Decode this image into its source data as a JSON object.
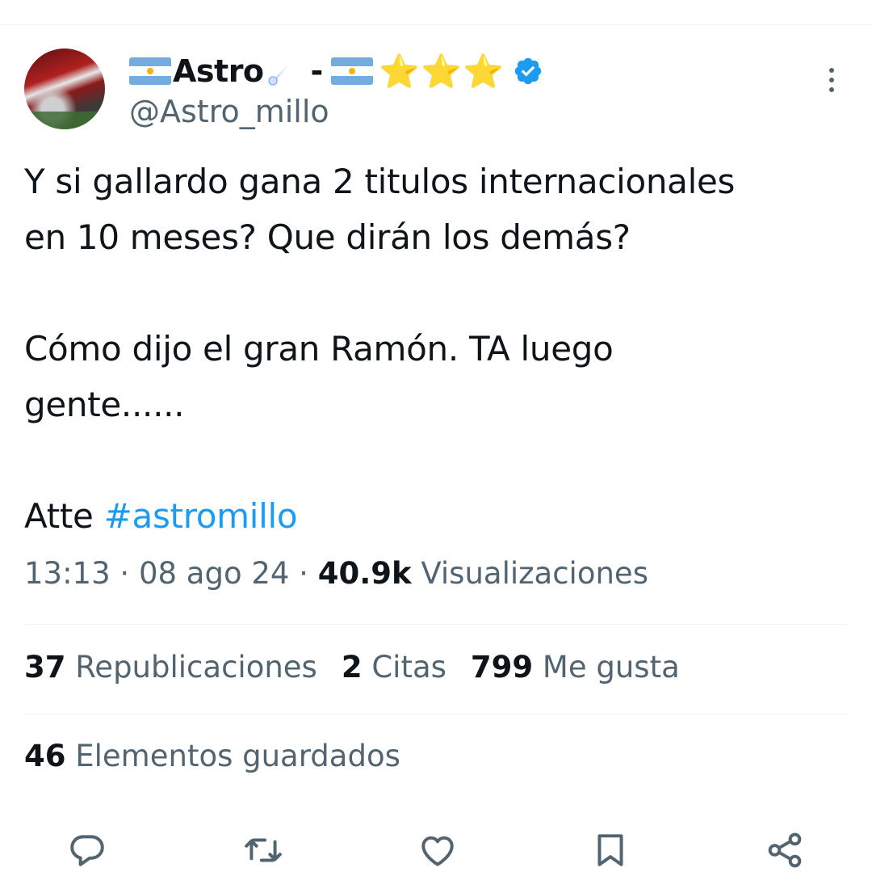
{
  "author": {
    "display_name_text": "Astro",
    "separator": "-",
    "stars": "⭐⭐⭐",
    "handle": "@Astro_millo",
    "verified": true
  },
  "tweet": {
    "line1": "Y si gallardo gana 2 titulos internacionales",
    "line2": "en 10 meses? Que dirán los demás?",
    "line3": "Cómo dijo el gran Ramón. TA luego",
    "line4": "gente......",
    "sign_prefix": "Atte ",
    "hashtag": "#astromillo"
  },
  "meta": {
    "time": "13:13",
    "dot1": " · ",
    "date": "08 ago 24",
    "dot2": " · ",
    "views_count": "40.9k",
    "views_label": " Visualizaciones"
  },
  "stats": {
    "retweets_count": "37",
    "retweets_label": " Republicaciones",
    "quotes_count": "2",
    "quotes_label": " Citas",
    "likes_count": "799",
    "likes_label": " Me gusta",
    "bookmarks_count": "46",
    "bookmarks_label": " Elementos guardados"
  },
  "icons": [
    "reply-icon",
    "retweet-icon",
    "like-icon",
    "bookmark-icon",
    "share-icon",
    "more-icon",
    "verified-badge-icon",
    "comet-icon",
    "argentina-flag-icon"
  ],
  "colors": {
    "text": "#0f1419",
    "secondary": "#536471",
    "link": "#1d9bf0",
    "divider": "#eff3f4",
    "verified": "#1d9bf0"
  }
}
